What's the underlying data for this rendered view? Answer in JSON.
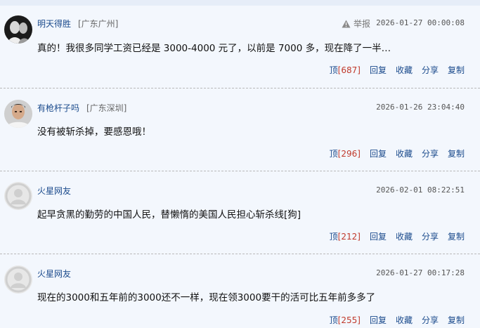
{
  "comments": [
    {
      "username": "明天得胜",
      "location": "[广东广州]",
      "report_label": "举报",
      "time": "2026-01-27 00:00:08",
      "text": "真的！我很多同学工资已经是 3000-4000 元了，以前是 7000 多，现在降了一半…",
      "up_label": "顶",
      "up_count": "[687]",
      "reply_label": "回复",
      "fav_label": "收藏",
      "share_label": "分享",
      "copy_label": "复制"
    },
    {
      "username": "有枪杆子吗",
      "location": "[广东深圳]",
      "time": "2026-01-26 23:04:40",
      "text": "没有被斩杀掉，要感恩哦！",
      "up_label": "顶",
      "up_count": "[296]",
      "reply_label": "回复",
      "fav_label": "收藏",
      "share_label": "分享",
      "copy_label": "复制"
    },
    {
      "username": "火星网友",
      "time": "2026-02-01 08:22:51",
      "text": "起早贪黑的勤劳的中国人民，替懒惰的美国人民担心斩杀线[狗]",
      "up_label": "顶",
      "up_count": "[212]",
      "reply_label": "回复",
      "fav_label": "收藏",
      "share_label": "分享",
      "copy_label": "复制"
    },
    {
      "username": "火星网友",
      "time": "2026-01-27 00:17:28",
      "text": "现在的3000和五年前的3000还不一样，现在领3000要干的活可比五年前多多了",
      "up_label": "顶",
      "up_count": "[255]",
      "reply_label": "回复",
      "fav_label": "收藏",
      "share_label": "分享",
      "copy_label": "复制"
    }
  ]
}
